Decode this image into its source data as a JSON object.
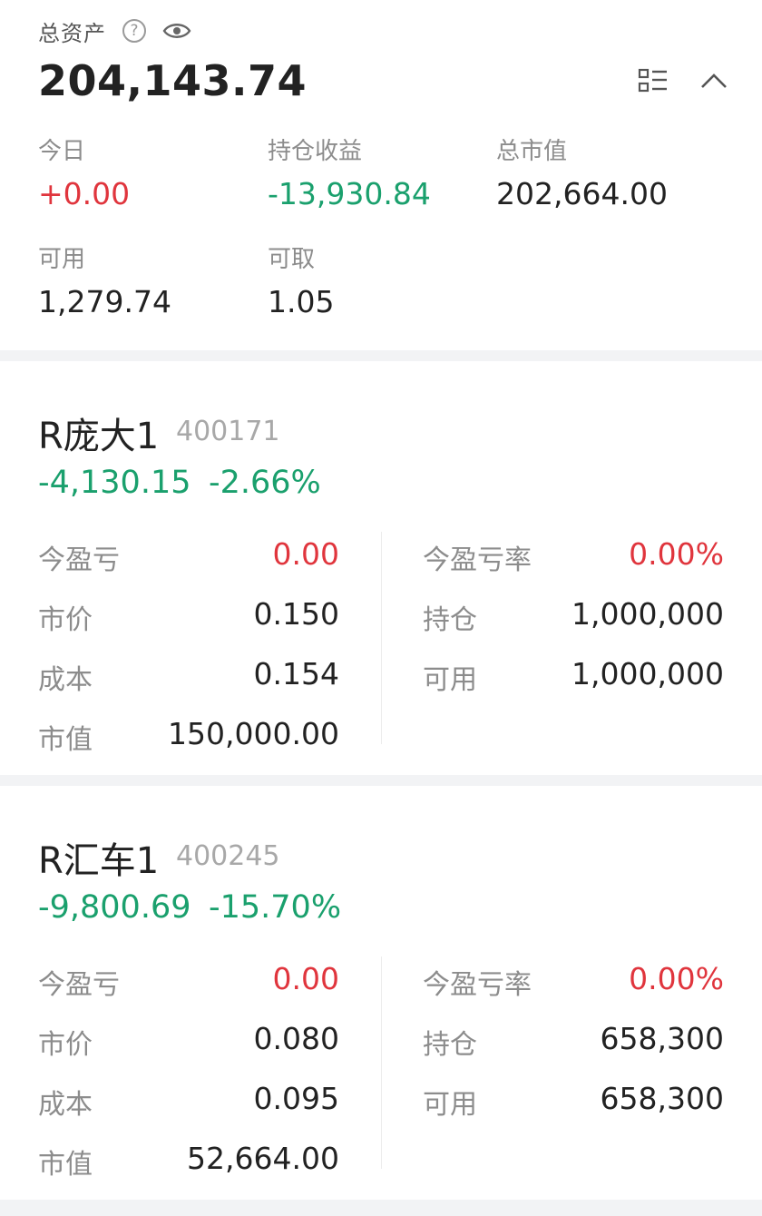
{
  "summary": {
    "title": "总资产",
    "total": "204,143.74",
    "today_label": "今日",
    "today_value": "+0.00",
    "holding_pnl_label": "持仓收益",
    "holding_pnl_value": "-13,930.84",
    "market_value_label": "总市值",
    "market_value_value": "202,664.00",
    "available_label": "可用",
    "available_value": "1,279.74",
    "withdrawable_label": "可取",
    "withdrawable_value": "1.05",
    "icons": [
      "help-icon",
      "eye-icon",
      "list-icon",
      "chevron-up-icon"
    ]
  },
  "labels": {
    "today_pnl": "今盈亏",
    "today_pnl_rate": "今盈亏率",
    "price": "市价",
    "position": "持仓",
    "cost": "成本",
    "available": "可用",
    "market_value": "市值"
  },
  "holdings": [
    {
      "name": "R庞大1",
      "code": "400171",
      "change": "-4,130.15",
      "change_pct": "-2.66%",
      "today_pnl": "0.00",
      "today_pnl_rate": "0.00%",
      "price": "0.150",
      "position": "1,000,000",
      "cost": "0.154",
      "available": "1,000,000",
      "market_value": "150,000.00"
    },
    {
      "name": "R汇车1",
      "code": "400245",
      "change": "-9,800.69",
      "change_pct": "-15.70%",
      "today_pnl": "0.00",
      "today_pnl_rate": "0.00%",
      "price": "0.080",
      "position": "658,300",
      "cost": "0.095",
      "available": "658,300",
      "market_value": "52,664.00"
    }
  ],
  "colors": {
    "up": "#e0353d",
    "down": "#1aa06d",
    "background": "#f2f3f5"
  }
}
